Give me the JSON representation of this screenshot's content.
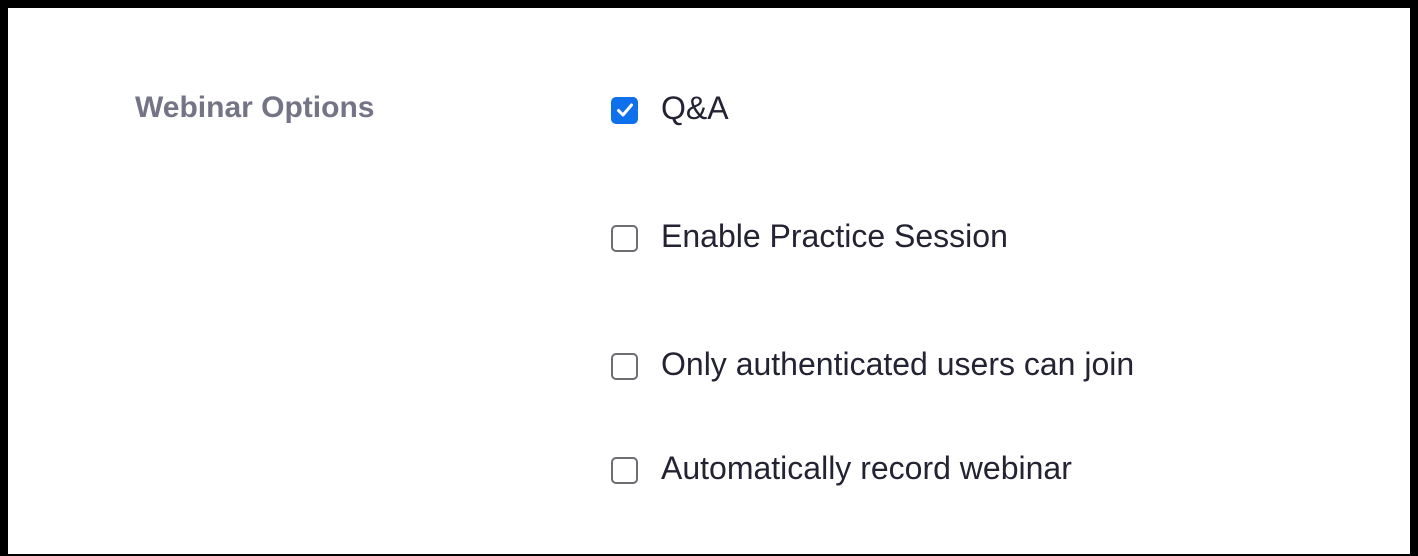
{
  "webinar_options": {
    "label": "Webinar Options",
    "accent_color": "#0e71eb",
    "options": [
      {
        "label": "Q&A",
        "checked": true,
        "icon": "checkmark-icon"
      },
      {
        "label": "Enable Practice Session",
        "checked": false
      },
      {
        "label": "Only authenticated users can join",
        "checked": false
      },
      {
        "label": "Automatically record webinar",
        "checked": false
      }
    ]
  }
}
